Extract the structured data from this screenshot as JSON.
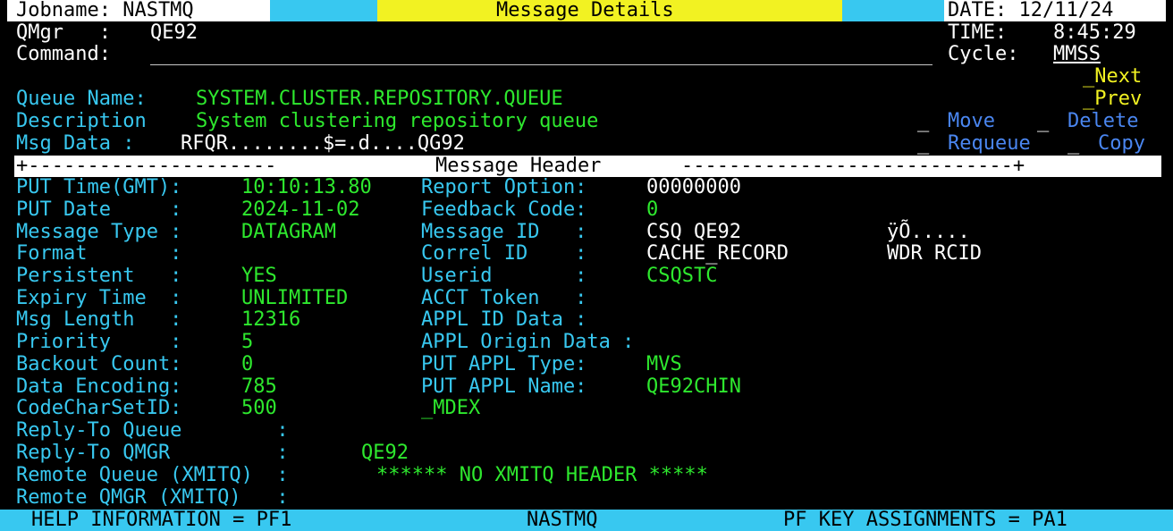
{
  "header": {
    "jobname": "Jobname: NASTMQ",
    "title": "Message Details",
    "date": "DATE: 12/11/24",
    "qmgr_label": "QMgr   :",
    "qmgr_value": "QE92",
    "time_label": "TIME:",
    "time_value": "8:45:29",
    "command_label": "Command:",
    "command_value": "",
    "cycle_label": "Cycle:",
    "cycle_value": "MMSS"
  },
  "actions": {
    "next": "_Next",
    "prev": "_Prev",
    "move_marker": "_",
    "move": "Move",
    "delete_marker": "_",
    "delete": "Delete",
    "requeue_marker": "_",
    "requeue": "Requeue",
    "copy_marker": "_",
    "copy": "Copy"
  },
  "queue": {
    "name_label": "Queue Name:",
    "name_value": "SYSTEM.CLUSTER.REPOSITORY.QUEUE",
    "desc_label": "Description",
    "desc_value": "System clustering repository queue",
    "msgdata_label": "Msg Data :",
    "msgdata_value": "RFQR........$=.d....QG92"
  },
  "section": {
    "left_rule": "+---------------------",
    "title": "Message Header",
    "right_rule": "----------------------------+"
  },
  "left_fields": [
    {
      "label": "PUT Time(GMT):",
      "value": "10:10:13.80"
    },
    {
      "label": "PUT Date     :",
      "value": "2024-11-02"
    },
    {
      "label": "Message Type :",
      "value": "DATAGRAM"
    },
    {
      "label": "Format       :",
      "value": ""
    },
    {
      "label": "Persistent   :",
      "value": "YES"
    },
    {
      "label": "Expiry Time  :",
      "value": "UNLIMITED"
    },
    {
      "label": "Msg Length   :",
      "value": "12316"
    },
    {
      "label": "Priority     :",
      "value": "5"
    },
    {
      "label": "Backout Count:",
      "value": "0"
    },
    {
      "label": "Data Encoding:",
      "value": "785"
    },
    {
      "label": "CodeCharSetID:",
      "value": "500"
    }
  ],
  "right_fields": [
    {
      "label": "Report Option:",
      "value": "00000000"
    },
    {
      "label": "Feedback Code:",
      "value": "0"
    },
    {
      "label": "Message ID   :",
      "value": "CSQ QE92",
      "extra": "ÿÕ....."
    },
    {
      "label": "Correl ID    :",
      "value": "CACHE_RECORD",
      "extra": "WDR RCID"
    },
    {
      "label": "Userid       :",
      "value": "CSQSTC"
    },
    {
      "label": "ACCT Token   :",
      "value": ""
    },
    {
      "label": "APPL ID Data :",
      "value": ""
    },
    {
      "label": "APPL Origin Data :",
      "value": ""
    },
    {
      "label": "PUT APPL Type:",
      "value": "MVS"
    },
    {
      "label": "PUT APPL Name:",
      "value": "QE92CHIN"
    },
    {
      "label": "_MDEX",
      "value": ""
    }
  ],
  "reply": [
    {
      "label": "Reply-To Queue        :",
      "value": ""
    },
    {
      "label": "Reply-To QMGR         :",
      "value": "QE92"
    },
    {
      "label": "Remote Queue (XMITQ)  :",
      "value": "****** NO XMITQ HEADER *****"
    },
    {
      "label": "Remote QMGR (XMITQ)   :",
      "value": ""
    }
  ],
  "footer": {
    "help": "HELP INFORMATION = PF1",
    "center": "NASTMQ",
    "pf": "PF KEY ASSIGNMENTS = PA1"
  },
  "colors": {
    "cyan": "#38c8f0",
    "yellow": "#f2f222",
    "green": "#2ee82e",
    "blue": "#4a86f0",
    "white": "#ffffff"
  }
}
